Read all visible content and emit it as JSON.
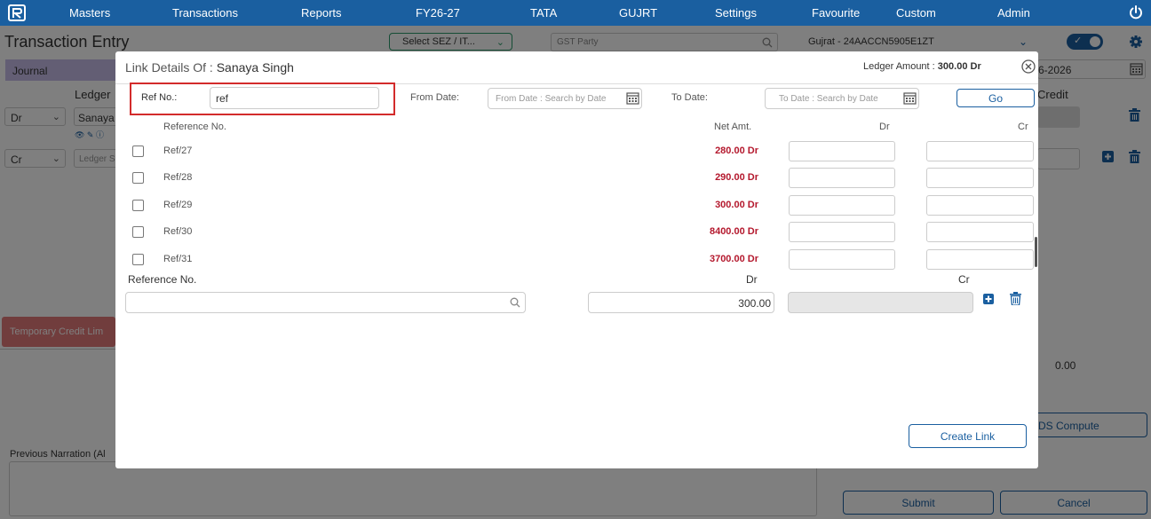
{
  "navbar": {
    "items": [
      "Masters",
      "Transactions",
      "Reports",
      "FY26-27",
      "TATA",
      "GUJRT",
      "Settings",
      "Favourite",
      "Custom",
      "Admin"
    ]
  },
  "page": {
    "title": "Transaction Entry",
    "sez_select": "Select SEZ / IT...",
    "gst_party_placeholder": "GST Party",
    "gstin_label": "Gujrat - 24AACCN5905E1ZT",
    "journal_tab": "Journal",
    "date_value": "6-2026",
    "ledger_header": "Ledger",
    "credit_header": "Credit",
    "row1": {
      "type": "Dr",
      "ledger": "Sanaya"
    },
    "row2": {
      "type": "Cr",
      "ledger_placeholder": "Ledger S"
    },
    "temp_credit_button": "Temporary Credit Lim",
    "total": "0.00",
    "tds_button": "DS Compute",
    "previous_narration_label": "Previous Narration (Al",
    "submit_button": "Submit",
    "cancel_button": "Cancel"
  },
  "modal": {
    "title_prefix": "Link Details Of :",
    "title_name": "Sanaya Singh",
    "ledger_amount_label": "Ledger Amount :",
    "ledger_amount_value": "300.00 Dr",
    "ref_no_label": "Ref No.:",
    "ref_no_value": "ref",
    "from_date_label": "From Date:",
    "from_date_placeholder": "From Date : Search by Date",
    "to_date_label": "To Date:",
    "to_date_placeholder": "To Date : Search by Date",
    "go_button": "Go",
    "columns": {
      "reference": "Reference No.",
      "net_amt": "Net Amt.",
      "dr": "Dr",
      "cr": "Cr"
    },
    "rows": [
      {
        "ref": "Ref/27",
        "amount": "280.00 Dr"
      },
      {
        "ref": "Ref/28",
        "amount": "290.00 Dr"
      },
      {
        "ref": "Ref/29",
        "amount": "300.00 Dr"
      },
      {
        "ref": "Ref/30",
        "amount": "8400.00 Dr"
      },
      {
        "ref": "Ref/31",
        "amount": "3700.00 Dr"
      }
    ],
    "entry": {
      "reference_label": "Reference No.",
      "dr_label": "Dr",
      "cr_label": "Cr",
      "dr_value": "300.00"
    },
    "create_link_button": "Create Link"
  },
  "colors": {
    "navbar": "#1a5fa0",
    "accent": "#1a5fa0",
    "amount_red": "#b4182d",
    "highlight": "#d32b2b",
    "journal_tab": "#c6bde8",
    "temp_credit": "#e37a7a"
  }
}
